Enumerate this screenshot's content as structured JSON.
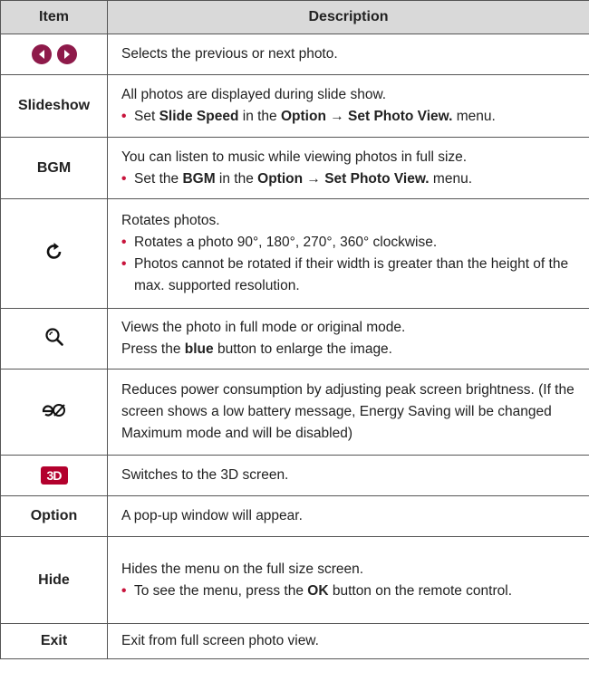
{
  "header": {
    "item": "Item",
    "description": "Description"
  },
  "rows": {
    "arrows": {
      "icon": "prev-next-arrows-icon",
      "line1": "Selects the previous or next photo."
    },
    "slideshow": {
      "label": "Slideshow",
      "line1": "All photos are displayed during slide show.",
      "b1_pre": "Set ",
      "b1_b1": "Slide Speed",
      "b1_mid": " in the ",
      "b1_b2": "Option",
      "b1_arrow": " → ",
      "b1_b3": "Set Photo View.",
      "b1_post": " menu."
    },
    "bgm": {
      "label": "BGM",
      "line1": "You can listen to music while viewing photos in full size.",
      "b1_pre": "Set the ",
      "b1_b1": "BGM",
      "b1_mid": " in the ",
      "b1_b2": "Option",
      "b1_arrow": " → ",
      "b1_b3": "Set Photo View.",
      "b1_post": " menu."
    },
    "rotate": {
      "icon": "rotate-icon",
      "line1": "Rotates photos.",
      "b1": "Rotates a photo 90°, 180°, 270°, 360° clockwise.",
      "b2": "Photos cannot be rotated if their width is greater than the height of the max. supported resolution."
    },
    "zoom": {
      "icon": "zoom-icon",
      "line1": "Views the photo in full mode or original mode.",
      "line2_pre": "Press the ",
      "line2_b": "blue",
      "line2_post": " button to enlarge the image."
    },
    "energy": {
      "icon": "energy-saving-icon",
      "line1": "Reduces power consumption by adjusting peak screen brightness. (If the screen shows a low battery message, Energy Saving will be changed Maximum mode and will be disabled)"
    },
    "three_d": {
      "icon_text": "3D",
      "line1": "Switches to the 3D screen."
    },
    "option": {
      "label": "Option",
      "line1": "A pop-up window will appear."
    },
    "hide": {
      "label": "Hide",
      "line1": "Hides the menu on the full size screen.",
      "b1_pre": "To see the menu, press the ",
      "b1_b": "OK",
      "b1_post": " button on the remote control."
    },
    "exit": {
      "label": "Exit",
      "line1": "Exit from full screen photo view."
    }
  },
  "colors": {
    "header_bg": "#d9d9d9",
    "bullet": "#c8143c",
    "arrow_icon": "#8e1a4a",
    "three_d_icon": "#b3002d"
  }
}
